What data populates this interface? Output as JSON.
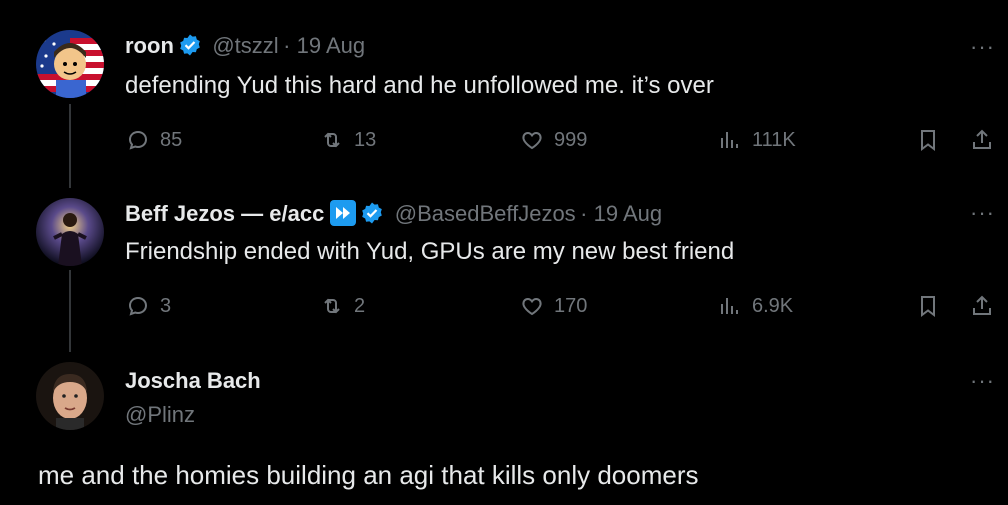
{
  "colors": {
    "background": "#000000",
    "text": "#e7e9ea",
    "muted": "#71767b",
    "verified": "#1d9bf0",
    "thread_line": "#333639"
  },
  "tweets": [
    {
      "name": "roon",
      "handle": "@tszzl",
      "date": "· 19 Aug",
      "text": "defending Yud this hard and he unfollowed me. it’s over",
      "replies": "85",
      "reposts": "13",
      "likes": "999",
      "views": "111K",
      "avatar_icon": "cartoon-flag-avatar"
    },
    {
      "name": "Beff Jezos — e/acc",
      "handle": "@BasedBeffJezos",
      "date": "· 19 Aug",
      "text": "Friendship ended with Yud, GPUs are my new best friend",
      "replies": "3",
      "reposts": "2",
      "likes": "170",
      "views": "6.9K",
      "avatar_icon": "cosmic-figure-avatar"
    }
  ],
  "quote": {
    "name": "Joscha Bach",
    "handle": "@Plinz",
    "text": "me and the homies building an agi that kills only doomers",
    "avatar_icon": "portrait-avatar"
  },
  "more_label": "···"
}
